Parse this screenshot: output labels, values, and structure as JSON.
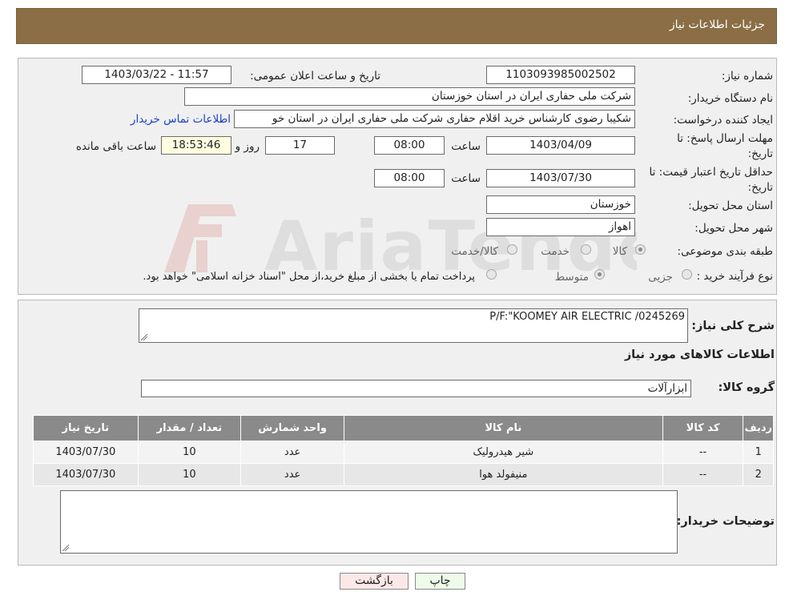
{
  "header": {
    "title": "جزئیات اطلاعات نیاز"
  },
  "form": {
    "need_number_label": "شماره نیاز:",
    "need_number": "1103093985002502",
    "announce_label": "تاریخ و ساعت اعلان عمومی:",
    "announce_value": "1403/03/22 - 11:57",
    "buyer_org_label": "نام دستگاه خریدار:",
    "buyer_org": "شرکت ملی حفاری ایران در استان خوزستان",
    "creator_label": "ایجاد کننده درخواست:",
    "creator": "شکیبا رضوی کارشناس خرید اقلام حفاری شرکت ملی حفاری ایران در استان خو",
    "contact_link": "اطلاعات تماس خریدار",
    "deadline_label": "مهلت ارسال پاسخ: تا تاریخ:",
    "deadline_date": "1403/04/09",
    "time_label": "ساعت",
    "deadline_time": "08:00",
    "days_value": "17",
    "days_label": "روز و",
    "remaining_time": "18:53:46",
    "remaining_label": "ساعت باقی مانده",
    "validity_label": "حداقل تاریخ اعتبار قیمت: تا تاریخ:",
    "validity_date": "1403/07/30",
    "validity_time": "08:00",
    "province_label": "استان محل تحویل:",
    "province": "خوزستان",
    "city_label": "شهر محل تحویل:",
    "city": "اهواز",
    "category_label": "طبقه بندی موضوعی:",
    "category_options": [
      "کالا",
      "خدمت",
      "کالا/خدمت"
    ],
    "process_label": "نوع فرآیند خرید :",
    "process_options": [
      "جزیی",
      "متوسط"
    ],
    "process_note": "پرداخت تمام یا بخشی از مبلغ خرید،از محل \"اسناد خزانه اسلامی\" خواهد بود."
  },
  "details": {
    "summary_label": "شرح کلی نیاز:",
    "summary_value": "P/F:\"KOOMEY AIR ELECTRIC /0245269",
    "items_heading": "اطلاعات کالاهای مورد نیاز",
    "group_label": "گروه کالا:",
    "group_value": "ابزارآلات",
    "table": {
      "headers": [
        "ردیف",
        "کد کالا",
        "نام کالا",
        "واحد شمارش",
        "تعداد / مقدار",
        "تاریخ نیاز"
      ],
      "rows": [
        [
          "1",
          "--",
          "شیر هیدرولیک",
          "عدد",
          "10",
          "1403/07/30"
        ],
        [
          "2",
          "--",
          "منیفولد هوا",
          "عدد",
          "10",
          "1403/07/30"
        ]
      ]
    },
    "buyer_notes_label": "توضیحات خریدار:",
    "buyer_notes_value": ""
  },
  "buttons": {
    "print": "چاپ",
    "back": "بازگشت"
  },
  "colors": {
    "header": "#8b6e45",
    "table_header": "#8a8a8a",
    "link": "#1a3fc7",
    "back_button": "#fde8e8",
    "print_button": "#eefbe8"
  }
}
